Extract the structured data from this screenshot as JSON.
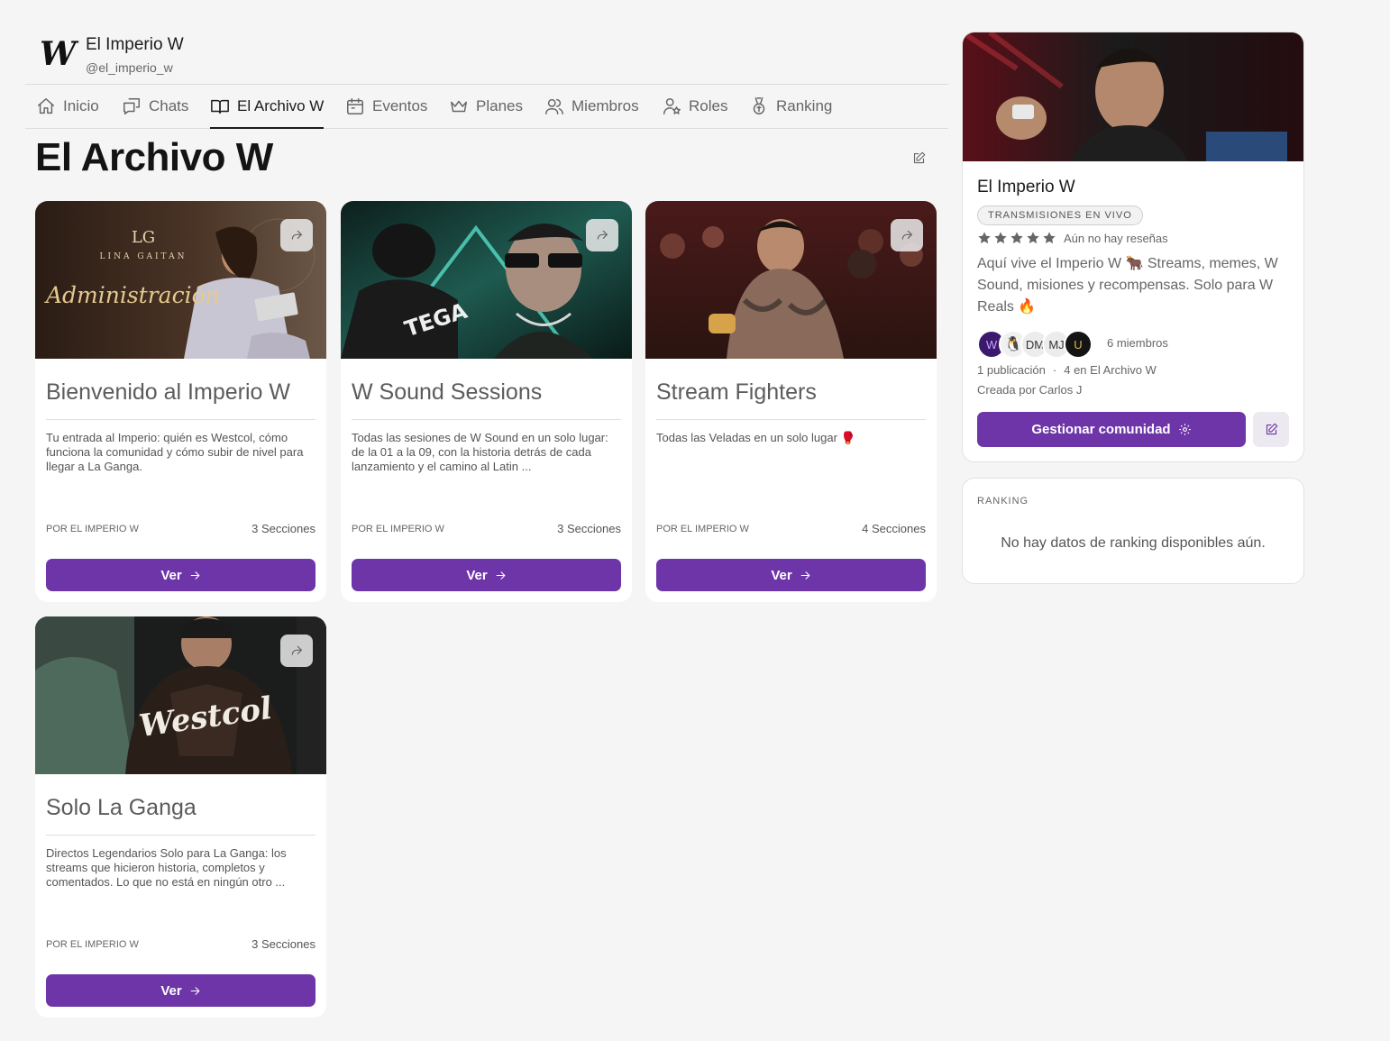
{
  "header": {
    "logo_letter": "W",
    "name": "El Imperio W",
    "handle": "@el_imperio_w"
  },
  "nav": {
    "tabs": [
      {
        "label": "Inicio",
        "icon": "home-icon"
      },
      {
        "label": "Chats",
        "icon": "chats-icon"
      },
      {
        "label": "El Archivo W",
        "icon": "book-icon",
        "active": true
      },
      {
        "label": "Eventos",
        "icon": "calendar-icon"
      },
      {
        "label": "Planes",
        "icon": "crown-icon"
      },
      {
        "label": "Miembros",
        "icon": "users-icon"
      },
      {
        "label": "Roles",
        "icon": "user-badge-icon"
      },
      {
        "label": "Ranking",
        "icon": "medal-icon"
      }
    ]
  },
  "page": {
    "title": "El Archivo W"
  },
  "cards": [
    {
      "title": "Bienvenido al Imperio W",
      "description": "Tu entrada al Imperio: quién es Westcol, cómo funciona la comunidad y cómo subir de nivel para llegar a La Ganga.",
      "author": "POR EL IMPERIO W",
      "sections": "3 Secciones",
      "button": "Ver",
      "image_text": {
        "monogram": "LG",
        "brand": "LINA GAITAN",
        "script": "Administración"
      }
    },
    {
      "title": "W Sound Sessions",
      "description": "Todas las sesiones de W Sound en un solo lugar: de la 01 a la 09, con la historia detrás de cada lanzamiento y el camino al Latin ...",
      "author": "POR EL IMPERIO W",
      "sections": "3 Secciones",
      "button": "Ver",
      "image_text": {
        "jersey": "TEGA"
      }
    },
    {
      "title": "Stream Fighters",
      "description": "Todas las Veladas en un solo lugar 🥊",
      "author": "POR EL IMPERIO W",
      "sections": "4 Secciones",
      "button": "Ver"
    },
    {
      "title": "Solo La Ganga",
      "description": "Directos Legendarios Solo para La Ganga: los streams que hicieron historia, completos y comentados. Lo que no está en ningún otro ...",
      "author": "POR EL IMPERIO W",
      "sections": "3 Secciones",
      "button": "Ver",
      "image_text": {
        "jacket": "Westcol"
      }
    }
  ],
  "community": {
    "name": "El Imperio W",
    "badge": "TRANSMISIONES EN VIVO",
    "rating_stars": 5,
    "reviews": "Aún no hay reseñas",
    "description": "Aquí vive el Imperio W 🐂 Streams, memes, W Sound, misiones y recompensas. Solo para W Reals 🔥",
    "avatars": [
      "W",
      "🐧",
      "DM",
      "MJ",
      "U"
    ],
    "members": "6 miembros",
    "publications": "1 publicación",
    "separator": "·",
    "archive_count": "4 en El Archivo W",
    "creator": "Creada por Carlos J",
    "manage_button": "Gestionar comunidad"
  },
  "ranking": {
    "label": "RANKING",
    "empty": "No hay datos de ranking disponibles aún."
  },
  "colors": {
    "accent": "#6d35a8",
    "background": "#f5f5f5"
  }
}
